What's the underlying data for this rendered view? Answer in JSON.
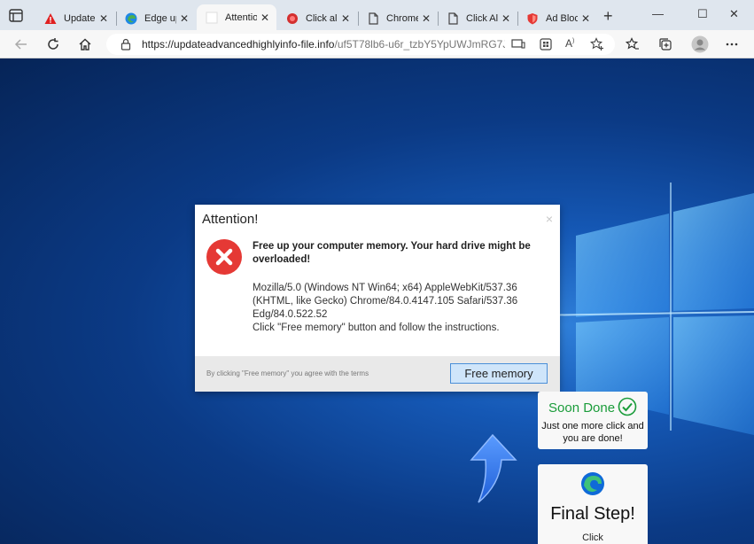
{
  "tabs": [
    {
      "title": "Update",
      "icon": "warning-icon",
      "active": false
    },
    {
      "title": "Edge up",
      "icon": "edge-icon",
      "active": false
    },
    {
      "title": "Attentio",
      "icon": "blank-page-icon",
      "active": true
    },
    {
      "title": "Click all",
      "icon": "red-circle-icon",
      "active": false
    },
    {
      "title": "Chrome",
      "icon": "page-icon",
      "active": false
    },
    {
      "title": "Click All",
      "icon": "page-icon",
      "active": false
    },
    {
      "title": "Ad Block",
      "icon": "shield-icon",
      "active": false
    }
  ],
  "new_tab_label": "+",
  "window_controls": {
    "minimize": "—",
    "maximize": "☐",
    "close": "✕"
  },
  "address_bar": {
    "host": "https://updateadvancedhighlyinfo-file.info",
    "path": "/uf5T78lb6-u6r_tzbY5YpUWJmRG7J..."
  },
  "dialog": {
    "title": "Attention!",
    "close_glyph": "×",
    "headline": "Free up your computer memory. Your hard drive might be overloaded!",
    "user_agent": "Mozilla/5.0 (Windows NT Win64; x64) AppleWebKit/537.36 (KHTML, like Gecko) Chrome/84.0.4147.105 Safari/537.36 Edg/84.0.522.52",
    "instruction": "Click \"Free memory\" button and follow the instructions.",
    "terms": "By clicking \"Free memory\" you agree with the terms",
    "button_label": "Free memory"
  },
  "soon_card": {
    "title": "Soon Done",
    "text": "Just one more click and you are done!"
  },
  "final_card": {
    "title": "Final Step!",
    "subtitle": "Click"
  },
  "colors": {
    "accent_green": "#1a9c3a",
    "error_red": "#e53935",
    "button_blue": "#cfe5fa",
    "arrow_blue": "#2f6fe0"
  }
}
